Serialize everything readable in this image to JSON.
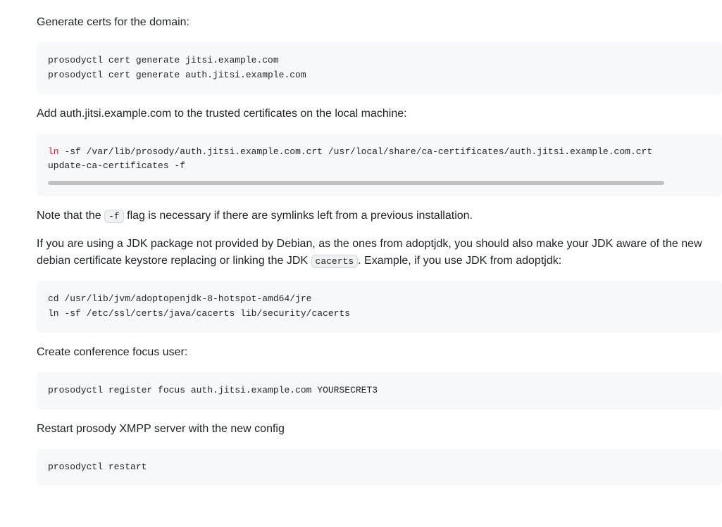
{
  "p1": "Generate certs for the domain:",
  "code1": "prosodyctl cert generate jitsi.example.com\nprosodyctl cert generate auth.jitsi.example.com",
  "p2": "Add auth.jitsi.example.com to the trusted certificates on the local machine:",
  "code2_kw": "ln",
  "code2_rest": " -sf /var/lib/prosody/auth.jitsi.example.com.crt /usr/local/share/ca-certificates/auth.jitsi.example.com.crt\nupdate-ca-certificates -f",
  "p3_a": "Note that the ",
  "p3_code": "-f",
  "p3_b": " flag is necessary if there are symlinks left from a previous installation.",
  "p4_a": "If you are using a JDK package not provided by Debian, as the ones from adoptjdk, you should also make your JDK aware of the new debian certificate keystore replacing or linking the JDK ",
  "p4_code": "cacerts",
  "p4_b": ". Example, if you use JDK from adoptjdk:",
  "code3": "cd /usr/lib/jvm/adoptopenjdk-8-hotspot-amd64/jre\nln -sf /etc/ssl/certs/java/cacerts lib/security/cacerts",
  "p5": "Create conference focus user:",
  "code4": "prosodyctl register focus auth.jitsi.example.com YOURSECRET3",
  "p6": "Restart prosody XMPP server with the new config",
  "code5": "prosodyctl restart"
}
